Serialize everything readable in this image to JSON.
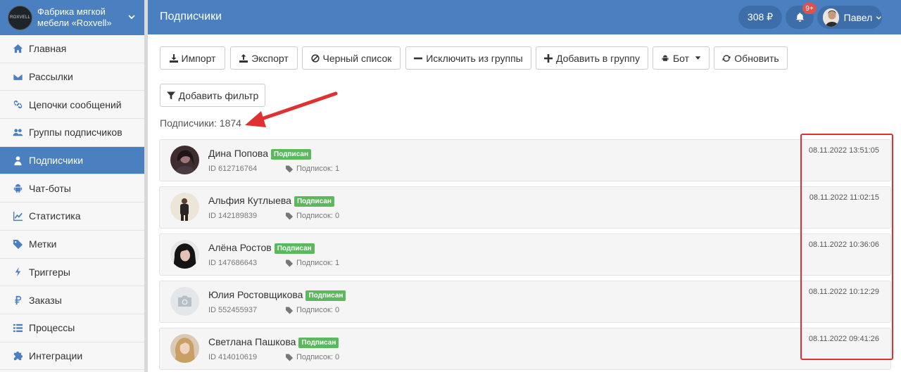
{
  "brand": {
    "name": "Фабрика мягкой мебели «Roxvell»",
    "logo_text": "ROXVELL"
  },
  "sidebar": {
    "items": [
      {
        "label": "Главная",
        "icon": "home-icon",
        "active": false
      },
      {
        "label": "Рассылки",
        "icon": "envelope-icon",
        "active": false
      },
      {
        "label": "Цепочки сообщений",
        "icon": "link-icon",
        "active": false
      },
      {
        "label": "Группы подписчиков",
        "icon": "users-icon",
        "active": false
      },
      {
        "label": "Подписчики",
        "icon": "user-icon",
        "active": true
      },
      {
        "label": "Чат-боты",
        "icon": "android-icon",
        "active": false
      },
      {
        "label": "Статистика",
        "icon": "line-chart-icon",
        "active": false
      },
      {
        "label": "Метки",
        "icon": "tag-icon",
        "active": false
      },
      {
        "label": "Триггеры",
        "icon": "bolt-icon",
        "active": false
      },
      {
        "label": "Заказы",
        "icon": "ruble-icon",
        "active": false
      },
      {
        "label": "Процессы",
        "icon": "list-icon",
        "active": false
      },
      {
        "label": "Интеграции",
        "icon": "puzzle-icon",
        "active": false
      }
    ]
  },
  "header": {
    "title": "Подписчики",
    "balance": "308 ₽",
    "notifications_badge": "9+",
    "user_name": "Павел"
  },
  "toolbar": {
    "import_label": "Импорт",
    "export_label": "Экспорт",
    "blacklist_label": "Черный список",
    "exclude_label": "Исключить из группы",
    "add_to_group_label": "Добавить в группу",
    "bot_label": "Бот",
    "refresh_label": "Обновить",
    "add_filter_label": "Добавить фильтр"
  },
  "subscribers_count_label": "Подписчики: 1874",
  "subscribers": [
    {
      "name": "Дина Попова",
      "status": "Подписан",
      "id": "ID 612716764",
      "subscriptions": "Подписок: 1",
      "date": "08.11.2022 13:51:05",
      "avatar": "photo"
    },
    {
      "name": "Альфия Кутлыева",
      "status": "Подписан",
      "id": "ID 142189839",
      "subscriptions": "Подписок: 0",
      "date": "08.11.2022 11:02:15",
      "avatar": "photo"
    },
    {
      "name": "Алёна Ростов",
      "status": "Подписан",
      "id": "ID 147686643",
      "subscriptions": "Подписок: 1",
      "date": "08.11.2022 10:36:06",
      "avatar": "photo"
    },
    {
      "name": "Юлия Ростовщикова",
      "status": "Подписан",
      "id": "ID 552455937",
      "subscriptions": "Подписок: 0",
      "date": "08.11.2022 10:12:29",
      "avatar": "camera-icon"
    },
    {
      "name": "Светлана Пашкова",
      "status": "Подписан",
      "id": "ID 414010619",
      "subscriptions": "Подписок: 0",
      "date": "08.11.2022 09:41:26",
      "avatar": "photo"
    }
  ],
  "colors": {
    "primary": "#4a7fc0",
    "success": "#5cb85c",
    "danger": "#d9534f",
    "annotation": "#e03030"
  }
}
